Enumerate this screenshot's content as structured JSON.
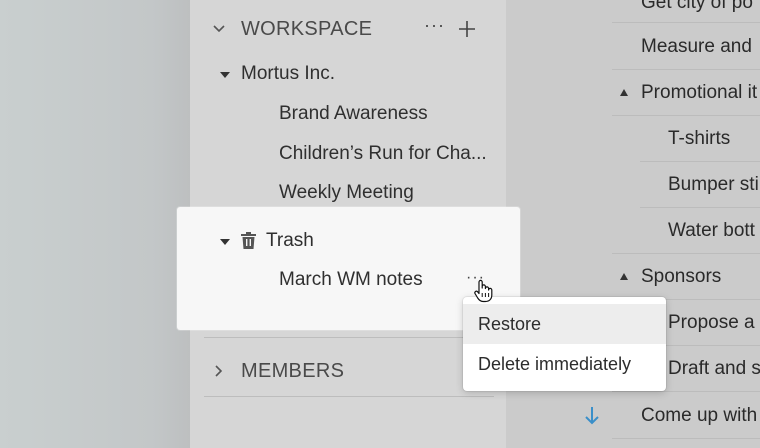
{
  "sidebar": {
    "workspace": {
      "title": "WORKSPACE",
      "more_label": "···",
      "icons": {
        "collapse": "chevron-down-icon",
        "more": "more-icon",
        "add": "plus-icon"
      }
    },
    "tree": {
      "org": "Mortus Inc.",
      "pages": [
        "Brand Awareness",
        "Children’s Run for Cha...",
        "Weekly Meeting"
      ]
    },
    "trash": {
      "label": "Trash",
      "icon": "trash-icon",
      "items": [
        "March WM notes"
      ],
      "item_more_label": "···"
    },
    "members": {
      "title": "MEMBERS",
      "icon": "chevron-right-icon"
    }
  },
  "context_menu": {
    "items": [
      "Restore",
      "Delete immediately"
    ],
    "hovered": "Restore"
  },
  "tasks": {
    "items": [
      "Get city of po",
      "Measure and",
      "Promotional it",
      "T-shirts",
      "Bumper sti",
      "Water bott",
      "Sponsors",
      "Propose a",
      "Draft and s",
      "Come up with"
    ],
    "arrow_icon": "arrow-down-icon",
    "accent": "#3a8fc9"
  },
  "colors": {
    "sidebar_bg": "#d6d6d6",
    "panel_bg": "#f7f7f7",
    "menu_hover": "#ededed"
  }
}
